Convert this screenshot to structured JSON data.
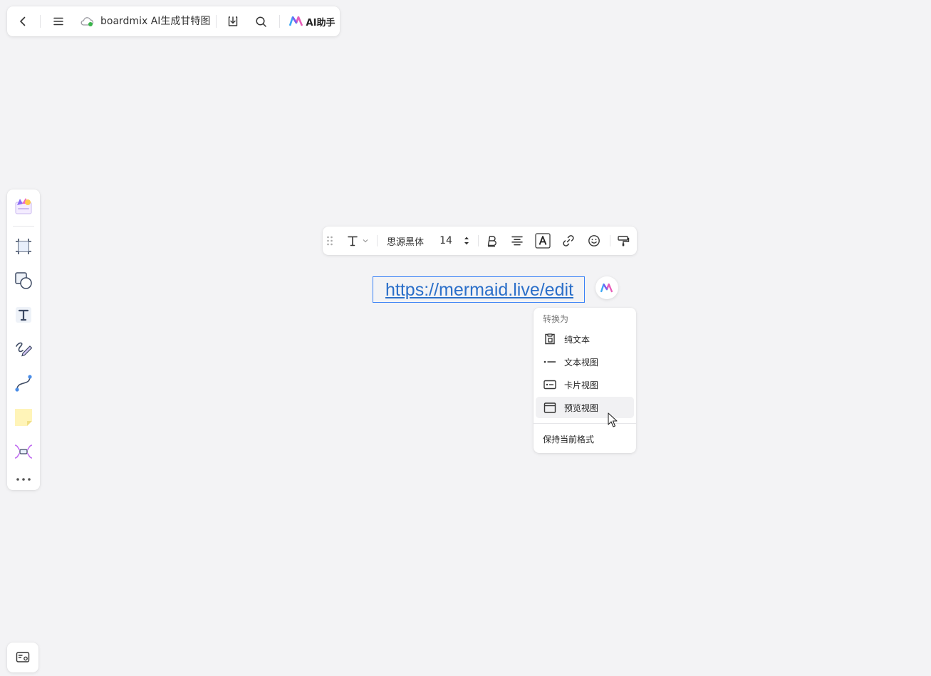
{
  "topbar": {
    "title": "boardmix AI生成甘特图",
    "ai_assistant_label": "AI助手",
    "icons": [
      "back-arrow-icon",
      "menu-icon",
      "cloud-sync-icon",
      "download-icon",
      "search-icon",
      "boardmix-ai-logo-icon"
    ],
    "cloud_status_color": "#39b54a"
  },
  "left_toolbar": {
    "tools": [
      "template-icon",
      "frame-icon",
      "shape-icon",
      "text-icon",
      "pen-icon",
      "connector-icon",
      "sticky-note-icon",
      "mind-map-icon",
      "more-icon"
    ]
  },
  "text_toolbar": {
    "font_name": "思源黑体",
    "font_size": "14",
    "icons": [
      "drag-handle-icon",
      "text-style-icon",
      "font-size-stepper-icon",
      "bold-icon",
      "align-center-icon",
      "text-color-icon",
      "link-icon",
      "emoji-icon",
      "format-painter-icon"
    ]
  },
  "canvas": {
    "link_text": "https://mermaid.live/edit",
    "link_color": "#2b6fc9",
    "selection_color": "#3b82f6"
  },
  "convert_menu": {
    "header": "转换为",
    "items": [
      {
        "label": "纯文本",
        "icon": "plain-text-icon"
      },
      {
        "label": "文本视图",
        "icon": "text-view-icon"
      },
      {
        "label": "卡片视图",
        "icon": "card-view-icon"
      },
      {
        "label": "预览视图",
        "icon": "preview-view-icon",
        "hovered": true
      }
    ],
    "keep_format_label": "保持当前格式"
  },
  "accent_colors": {
    "ai_purple": "#7b5cf0",
    "ai_pink": "#e85db8",
    "ai_blue": "#3ba7f5"
  }
}
